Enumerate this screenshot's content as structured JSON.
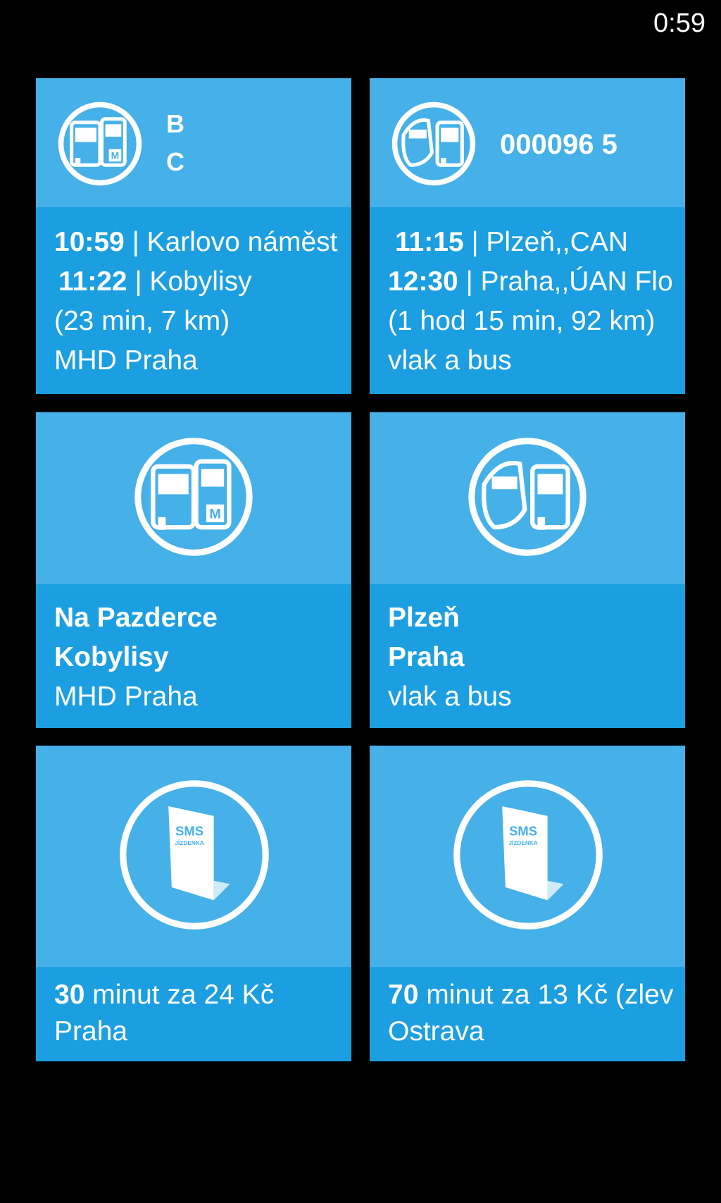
{
  "status": {
    "time": "0:59"
  },
  "tiles": [
    {
      "header": {
        "line1": "B",
        "line2": "C"
      },
      "icon": "bus-metro-icon",
      "lines": [
        {
          "time": "10:59",
          "text": "| Karlovo náměst"
        },
        {
          "time": "11:22",
          "text": "| Kobylisy"
        }
      ],
      "duration": "(23 min, 7 km)",
      "network": "MHD Praha"
    },
    {
      "header": {
        "number": "000096 5"
      },
      "icon": "train-bus-icon",
      "lines": [
        {
          "time": "11:15",
          "text": "| Plzeň,,CAN"
        },
        {
          "time": "12:30",
          "text": "| Praha,,ÚAN Flo"
        }
      ],
      "duration": "(1 hod 15 min, 92 km)",
      "network": "vlak a bus"
    },
    {
      "icon": "bus-metro-icon",
      "from": "Na Pazderce",
      "to": "Kobylisy",
      "network": "MHD Praha"
    },
    {
      "icon": "train-bus-icon",
      "from": "Plzeň",
      "to": "Praha",
      "network": "vlak a bus"
    },
    {
      "icon": "sms-ticket-icon",
      "sms_label": "SMS",
      "sms_sub": "JÍZDENKA",
      "minutes": "30",
      "price_text": "minut za 24 Kč",
      "city": "Praha"
    },
    {
      "icon": "sms-ticket-icon",
      "sms_label": "SMS",
      "sms_sub": "JÍZDENKA",
      "minutes": "70",
      "price_text": "minut za 13 Kč (zlev",
      "city": "Ostrava"
    }
  ],
  "colors": {
    "tile_top": "#46b0e8",
    "tile_bottom": "#1c9fe0",
    "background": "#000000"
  }
}
